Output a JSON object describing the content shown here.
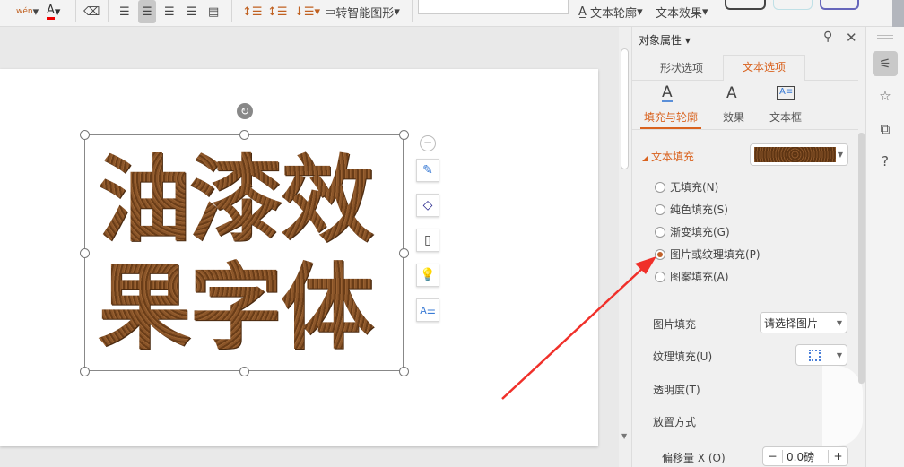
{
  "toolbar": {
    "text_outline": "文本轮廓",
    "text_effect": "文本效果",
    "smart_shape": "转智能图形",
    "pinyin_label": "wén"
  },
  "slide": {
    "line1": "油漆效",
    "line2": "果字体"
  },
  "panel": {
    "title": "对象属性",
    "tabs": [
      "形状选项",
      "文本选项"
    ],
    "subtabs": [
      "填充与轮廓",
      "效果",
      "文本框"
    ],
    "section": "文本填充",
    "fill_options": [
      "无填充(N)",
      "纯色填充(S)",
      "渐变填充(G)",
      "图片或纹理填充(P)",
      "图案填充(A)"
    ],
    "selected_fill": 3,
    "picture_fill_label": "图片填充",
    "picture_fill_value": "请选择图片",
    "texture_fill_label": "纹理填充(U)",
    "transparency_label": "透明度(T)",
    "placement_label": "放置方式",
    "offset_x_label": "偏移量 X (O)",
    "offset_x_value": "0.0磅"
  },
  "colors": {
    "accent": "#d9621e",
    "texture": "#7b4a22",
    "arrow": "#f0302a"
  }
}
